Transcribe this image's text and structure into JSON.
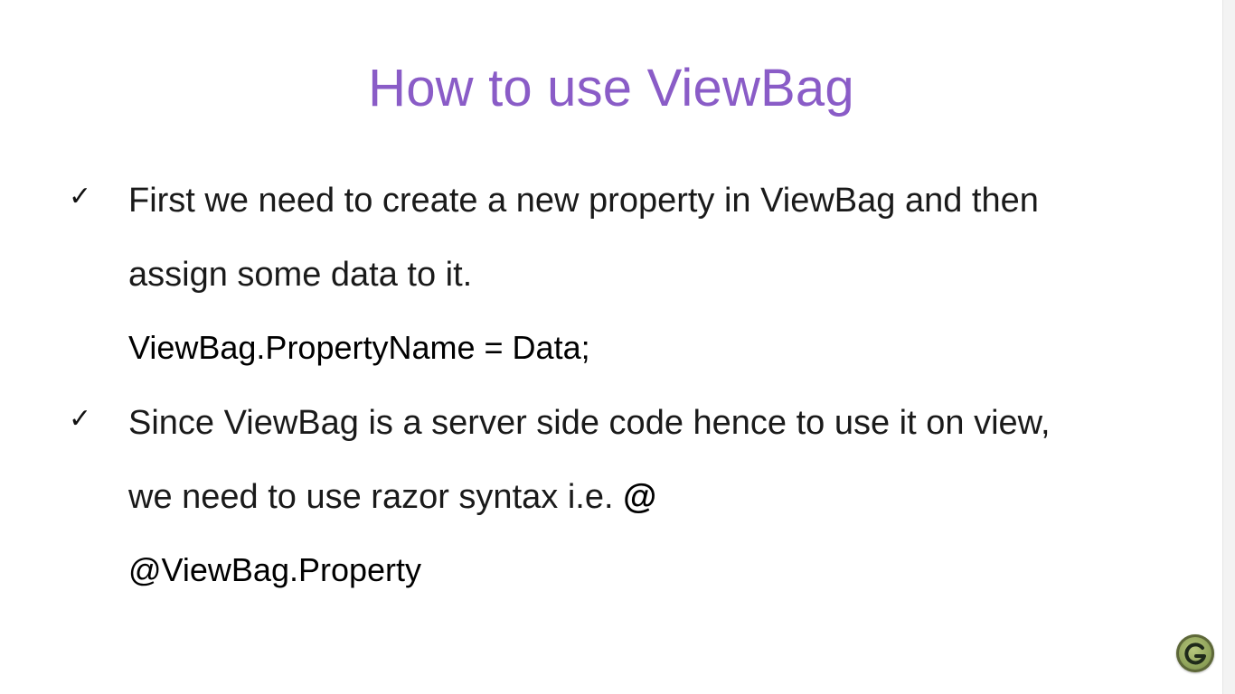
{
  "slide": {
    "title": "How to use ViewBag",
    "bullets": [
      {
        "icon": "checkmark-icon",
        "lines": [
          "First we need to create a new property in ViewBag and then",
          "assign some data to it."
        ],
        "code": "ViewBag.PropertyName = Data;"
      },
      {
        "icon": "checkmark-icon",
        "lines": [
          "Since ViewBag is a server side code hence to use it on view,",
          "we need to use razor syntax i.e. "
        ],
        "emphasis": "@",
        "code": "@ViewBag.Property"
      }
    ]
  },
  "colors": {
    "title": "#8a5cc7",
    "text": "#1a1a1a",
    "logo": "#8fa35a"
  },
  "logo": {
    "icon": "brand-logo-icon"
  }
}
